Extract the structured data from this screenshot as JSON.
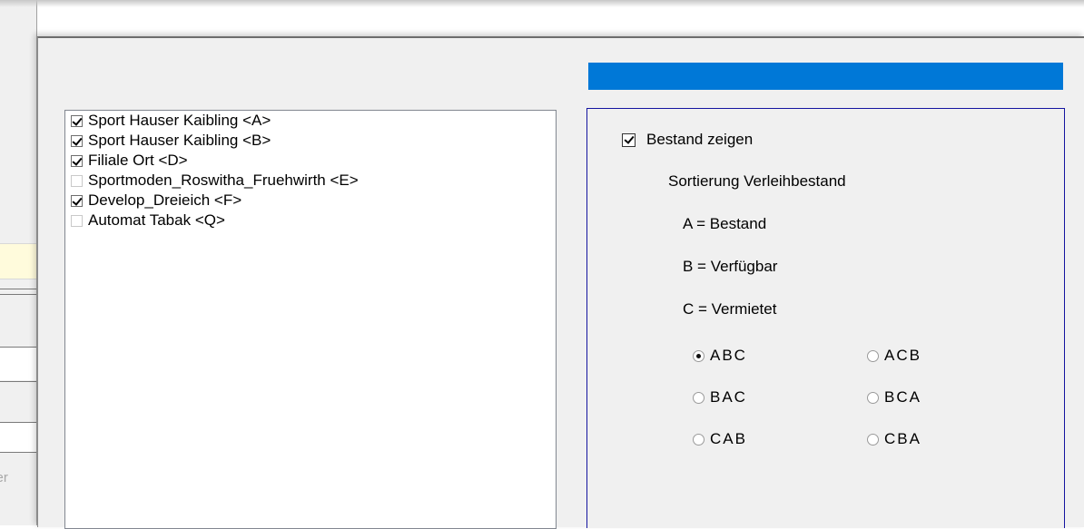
{
  "background_window": {
    "partial_text": "tier"
  },
  "branches": {
    "items": [
      {
        "label": "Sport Hauser Kaibling <A>",
        "checked": true
      },
      {
        "label": "Sport Hauser Kaibling <B>",
        "checked": true
      },
      {
        "label": "Filiale Ort <D>",
        "checked": true
      },
      {
        "label": "Sportmoden_Roswitha_Fruehwirth <E>",
        "checked": false
      },
      {
        "label": "Develop_Dreieich <F>",
        "checked": true
      },
      {
        "label": "Automat Tabak <Q>",
        "checked": false
      }
    ]
  },
  "options": {
    "show_stock_label": "Bestand zeigen",
    "show_stock_checked": true,
    "sort_title": "Sortierung Verleihbestand",
    "legend": [
      "A =  Bestand",
      "B =  Verfügbar",
      "C =  Vermietet"
    ],
    "sort_orders": [
      {
        "label": "ABC",
        "selected": true
      },
      {
        "label": "ACB",
        "selected": false
      },
      {
        "label": "BAC",
        "selected": false
      },
      {
        "label": "BCA",
        "selected": false
      },
      {
        "label": "CAB",
        "selected": false
      },
      {
        "label": "CBA",
        "selected": false
      }
    ]
  },
  "colors": {
    "accent_bar": "#0078d7",
    "group_border": "#1414a0",
    "dialog_bg": "#f0f0f0"
  }
}
